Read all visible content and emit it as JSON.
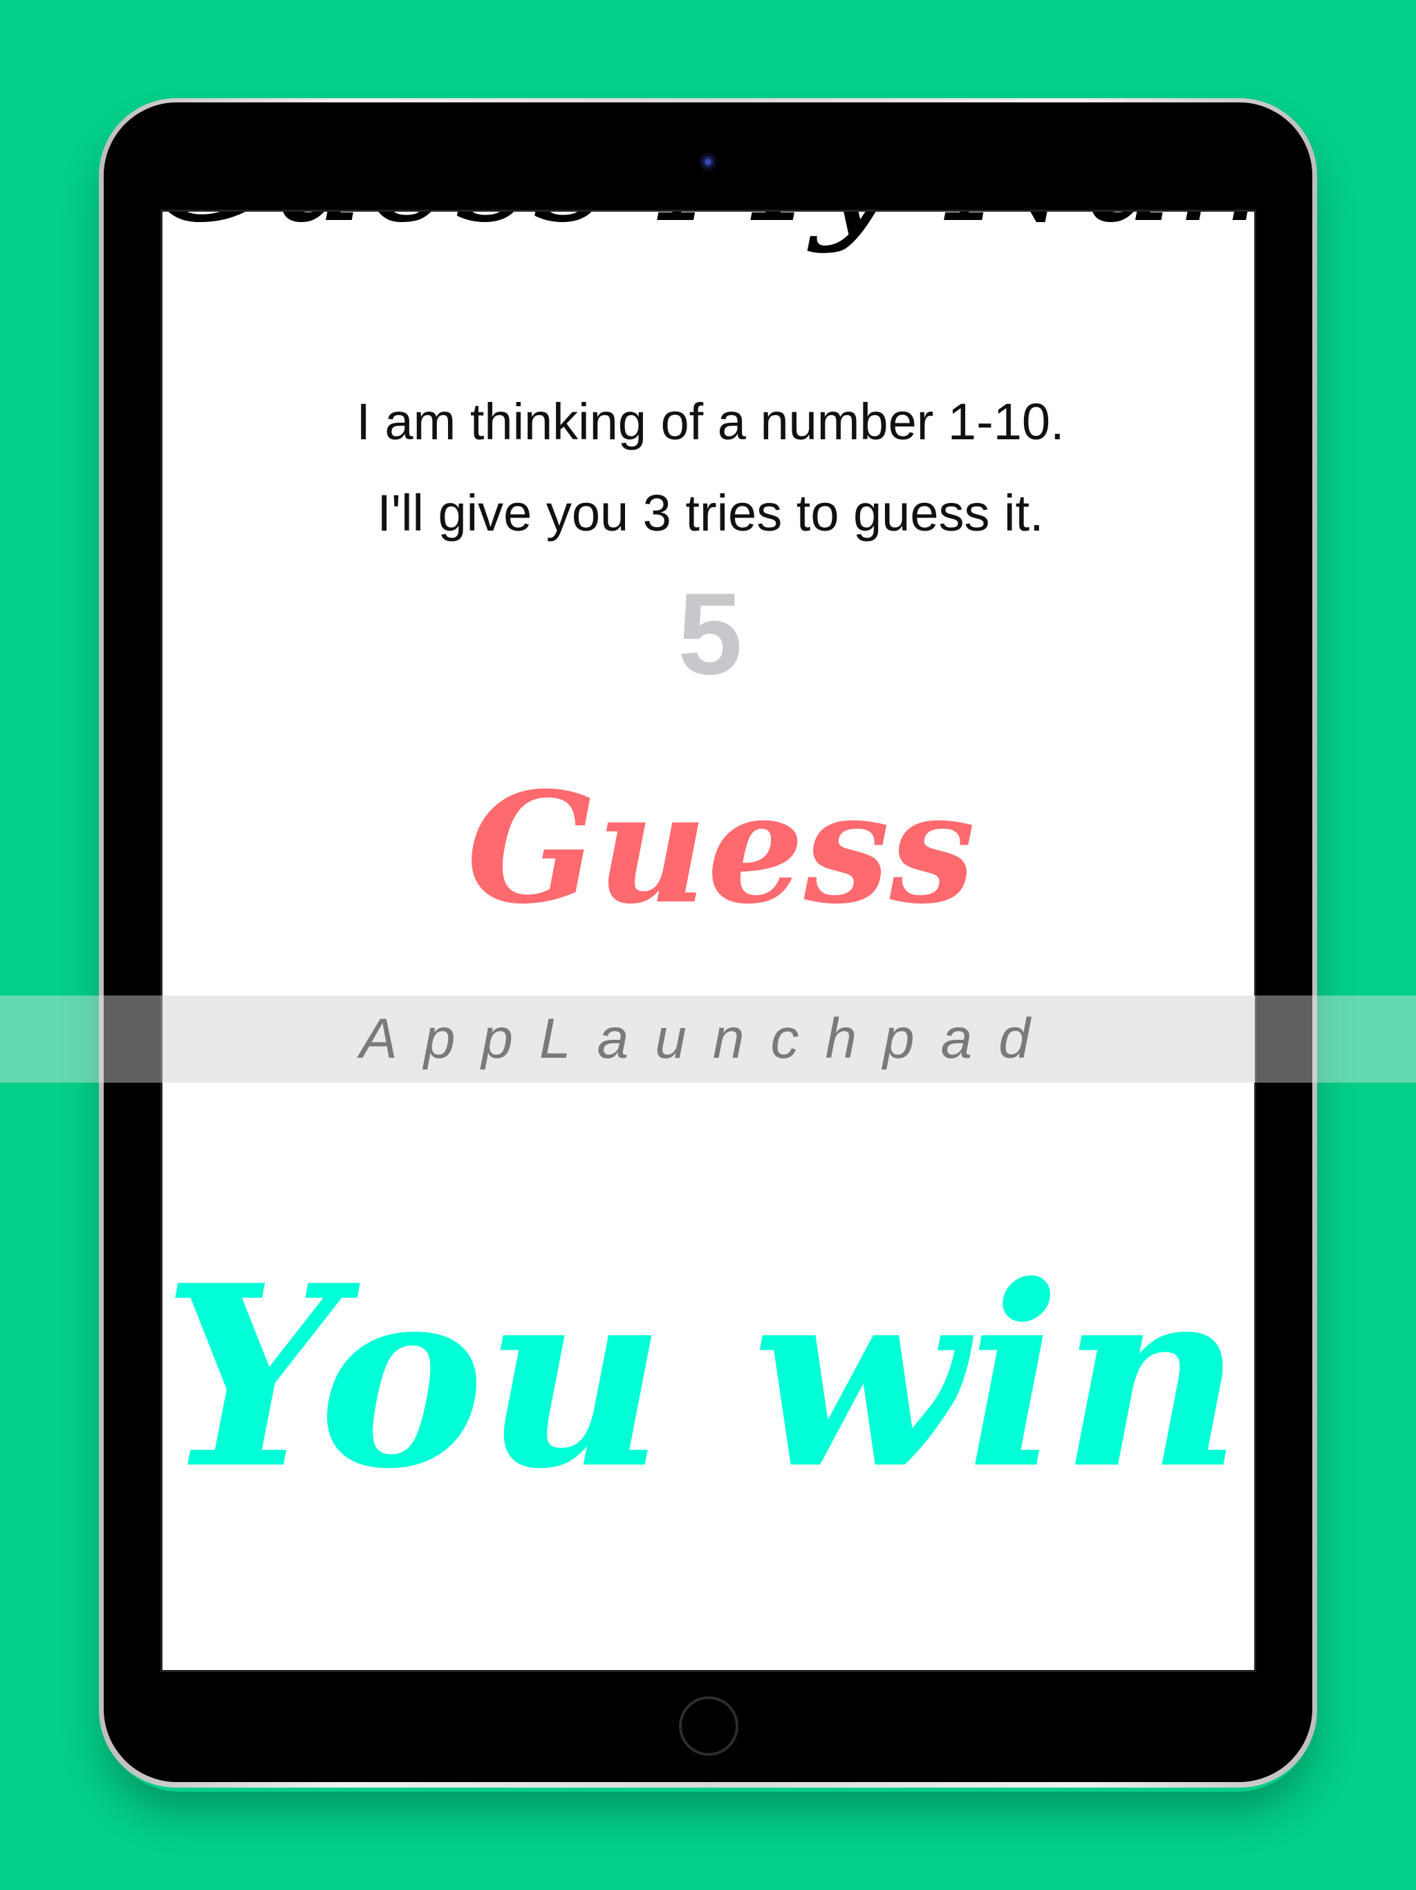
{
  "app": {
    "title": "Guess My Number",
    "instructions": [
      "I am thinking of a number 1-10.",
      "I'll give you 3 tries to guess it."
    ],
    "guess_input": {
      "value": "5",
      "placeholder": ""
    },
    "guess_button_label": "Guess",
    "result_text": "You win!"
  },
  "watermark": {
    "text": "AppLaunchpad"
  },
  "colors": {
    "background": "#03cf88",
    "device_frame": "#000000",
    "screen": "#ffffff",
    "guess_button": "#ff6a6f",
    "result_text": "#00ffd6",
    "input_text": "#c8c7cc"
  }
}
